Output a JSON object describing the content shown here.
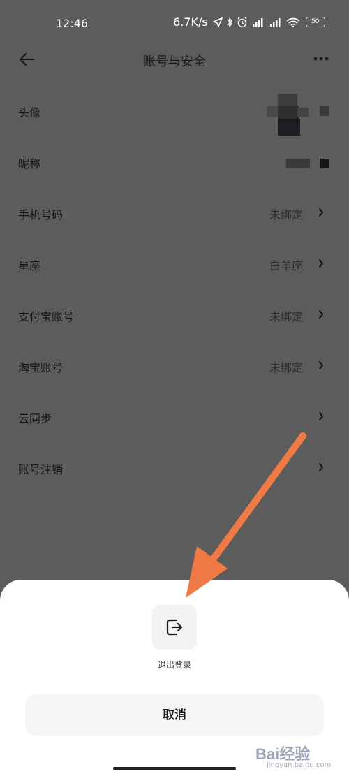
{
  "status_bar": {
    "time": "12:46",
    "speed": "6.7K/s",
    "battery": "50",
    "icons": [
      "location-icon",
      "bluetooth-icon",
      "alarm-icon",
      "signal-hd-icon",
      "signal-hd-icon",
      "wifi-icon",
      "battery-icon"
    ]
  },
  "header": {
    "title": "账号与安全",
    "back_icon": "back-arrow-icon",
    "more_icon": "more-icon"
  },
  "settings": {
    "avatar": {
      "label": "头像"
    },
    "nickname": {
      "label": "昵称"
    },
    "items": [
      {
        "label": "手机号码",
        "value": "未绑定"
      },
      {
        "label": "星座",
        "value": "白羊座"
      },
      {
        "label": "支付宝账号",
        "value": "未绑定"
      },
      {
        "label": "淘宝账号",
        "value": "未绑定"
      },
      {
        "label": "云同步",
        "value": ""
      },
      {
        "label": "账号注销",
        "value": ""
      }
    ]
  },
  "sheet": {
    "logout_label": "退出登录",
    "logout_icon": "logout-icon",
    "cancel_label": "取消"
  },
  "annotation": {
    "arrow_color": "#f07a45"
  },
  "watermark": {
    "brand": "Bai经验",
    "url": "jingyan.baidu.com"
  }
}
